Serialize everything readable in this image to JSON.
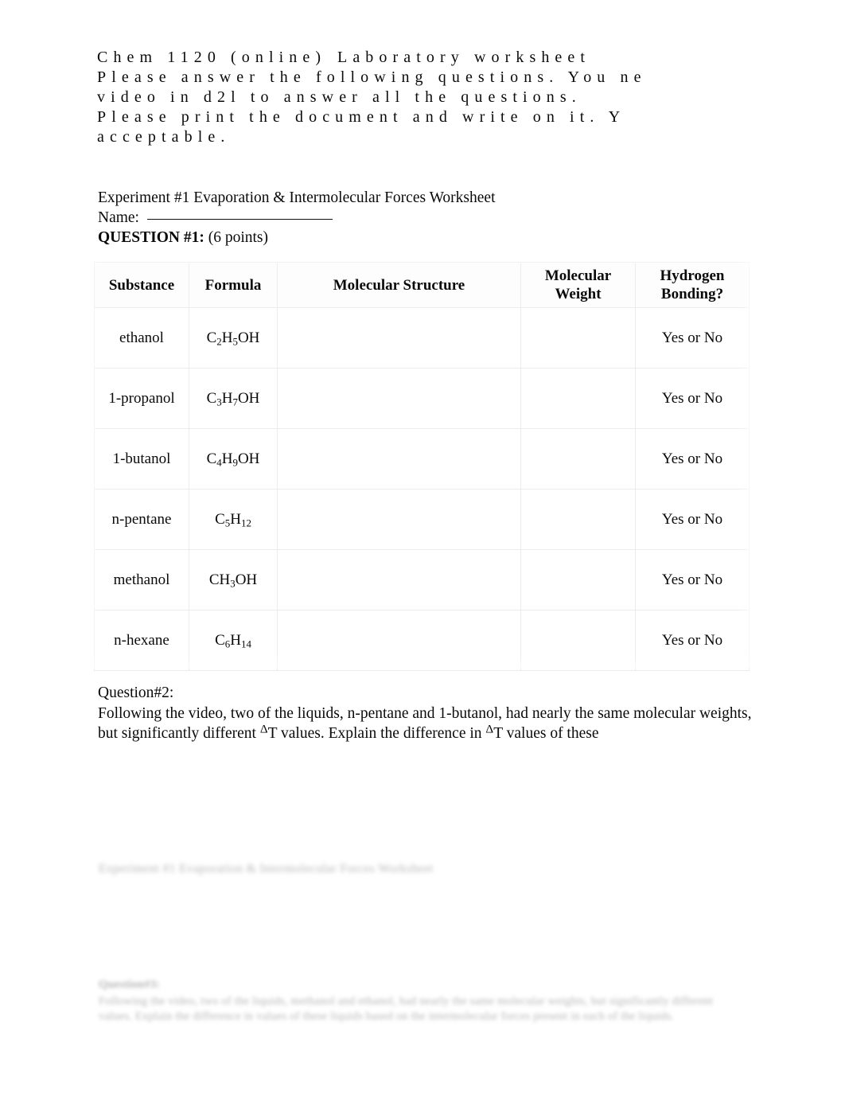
{
  "header": {
    "line1_part1": "Chem 1120 (online)",
    "line1_part2": "Laboratory worksheet",
    "line2": "Please answer the following questions. You ne",
    "line3": "video in d2l to answer all the questions.",
    "line4": "Please print the document and write on it. Y",
    "line5": "acceptable."
  },
  "title": "Experiment #1 Evaporation & Intermolecular Forces Worksheet",
  "name_field": {
    "label": "Name:",
    "value": ""
  },
  "question1": {
    "label": "QUESTION #1:",
    "points": "(6 points)"
  },
  "table": {
    "headers": [
      "Substance",
      "Formula",
      "Molecular Structure",
      "Molecular\nWeight",
      "Hydrogen\nBonding?"
    ],
    "headers_flat": {
      "substance": "Substance",
      "formula": "Formula",
      "structure": "Molecular Structure",
      "mw_line1": "Molecular",
      "mw_line2": "Weight",
      "hb_line1": "Hydrogen",
      "hb_line2": "Bonding?"
    },
    "rows": [
      {
        "substance": "ethanol",
        "formula_parts": [
          {
            "t": "C",
            "sub": false
          },
          {
            "t": "2",
            "sub": true
          },
          {
            "t": "H",
            "sub": false
          },
          {
            "t": "5",
            "sub": true
          },
          {
            "t": "OH",
            "sub": false
          }
        ],
        "structure": "",
        "molecular_weight": "",
        "hydrogen_bonding": "Yes or No"
      },
      {
        "substance": "1-propanol",
        "formula_parts": [
          {
            "t": "C",
            "sub": false
          },
          {
            "t": "3",
            "sub": true
          },
          {
            "t": "H",
            "sub": false
          },
          {
            "t": "7",
            "sub": true
          },
          {
            "t": "OH",
            "sub": false
          }
        ],
        "structure": "",
        "molecular_weight": "",
        "hydrogen_bonding": "Yes or No"
      },
      {
        "substance": "1-butanol",
        "formula_parts": [
          {
            "t": "C",
            "sub": false
          },
          {
            "t": "4",
            "sub": true
          },
          {
            "t": "H",
            "sub": false
          },
          {
            "t": "9",
            "sub": true
          },
          {
            "t": "OH",
            "sub": false
          }
        ],
        "structure": "",
        "molecular_weight": "",
        "hydrogen_bonding": "Yes or No"
      },
      {
        "substance": "n-pentane",
        "formula_parts": [
          {
            "t": "C",
            "sub": false
          },
          {
            "t": "5",
            "sub": true
          },
          {
            "t": "H",
            "sub": false
          },
          {
            "t": "12",
            "sub": true
          }
        ],
        "structure": "",
        "molecular_weight": "",
        "hydrogen_bonding": "Yes or No"
      },
      {
        "substance": "methanol",
        "formula_parts": [
          {
            "t": "CH",
            "sub": false
          },
          {
            "t": "3",
            "sub": true
          },
          {
            "t": "OH",
            "sub": false
          }
        ],
        "structure": "",
        "molecular_weight": "",
        "hydrogen_bonding": "Yes or No"
      },
      {
        "substance": "n-hexane",
        "formula_parts": [
          {
            "t": "C",
            "sub": false
          },
          {
            "t": "6",
            "sub": true
          },
          {
            "t": "H",
            "sub": false
          },
          {
            "t": "14",
            "sub": true
          }
        ],
        "structure": "",
        "molecular_weight": "",
        "hydrogen_bonding": "Yes or No"
      }
    ]
  },
  "question2": {
    "label": "Question#2:",
    "text_a": "Following the video, two of the liquids, n-pentane and 1-butanol, had nearly the same molecular weights, but significantly different ",
    "delta": "Δ",
    "text_b": "T values. Explain the difference in ",
    "text_c": "T values of these"
  },
  "faded": {
    "line": "Experiment #1 Evaporation & Intermolecular Forces Worksheet",
    "paragraph_head": "Question#3:",
    "paragraph_body": "Following the video, two of the liquids, methanol and ethanol, had nearly the same molecular weights, but significantly different values. Explain the difference in values of these liquids based on the intermolecular forces present in each of the liquids."
  },
  "colors": {
    "page_background": "#ffffff",
    "text": "#0a0a0a",
    "table_border": "#ececed",
    "ghost_text": "#87878b"
  }
}
